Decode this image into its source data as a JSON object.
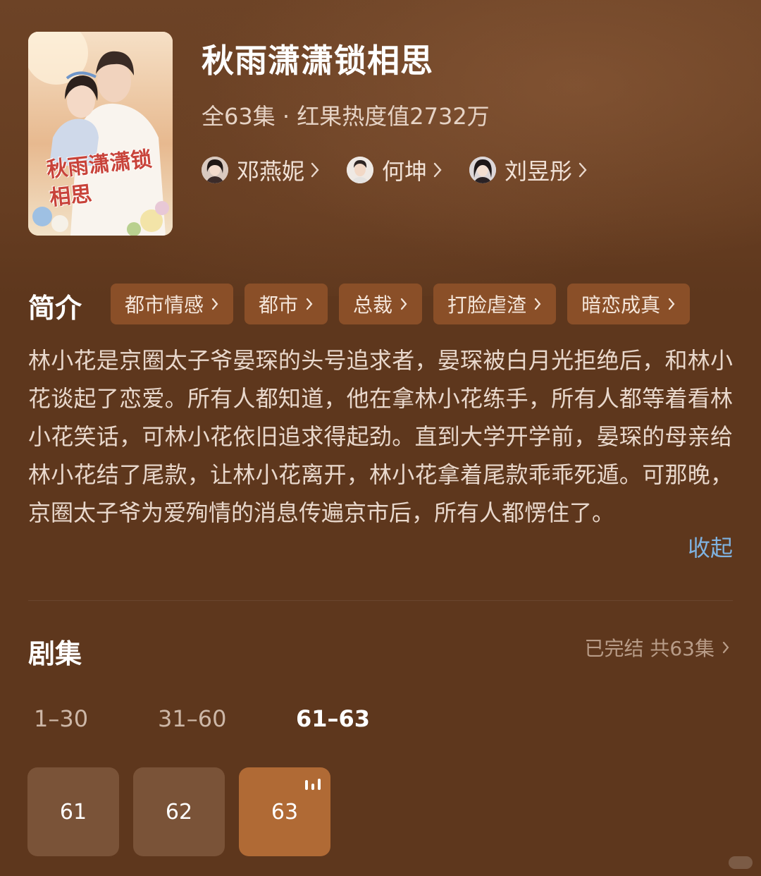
{
  "show": {
    "title": "秋雨潇潇锁相思",
    "meta": "全63集 · 红果热度值2732万",
    "poster_text": "秋雨潇潇锁相思"
  },
  "cast": [
    {
      "name": "邓燕妮",
      "icon": "avatar"
    },
    {
      "name": "何坤",
      "icon": "avatar"
    },
    {
      "name": "刘昱彤",
      "icon": "avatar"
    }
  ],
  "intro": {
    "heading": "简介",
    "tags": [
      "都市情感",
      "都市",
      "总裁",
      "打脸虐渣",
      "暗恋成真"
    ],
    "synopsis": "林小花是京圈太子爷晏琛的头号追求者，晏琛被白月光拒绝后，和林小花谈起了恋爱。所有人都知道，他在拿林小花练手，所有人都等着看林小花笑话，可林小花依旧追求得起劲。直到大学开学前，晏琛的母亲给林小花结了尾款，让林小花离开，林小花拿着尾款乖乖死遁。可那晚，京圈太子爷为爱殉情的消息传遍京市后，所有人都愣住了。",
    "collapse_label": "收起"
  },
  "episodes": {
    "heading": "剧集",
    "status": "已完结 共63集",
    "ranges": [
      "1–30",
      "31–60",
      "61–63"
    ],
    "active_range_index": 2,
    "items": [
      "61",
      "62",
      "63"
    ],
    "playing_index": 2
  },
  "colors": {
    "background": "#5e371d",
    "tag_bg": "#8a4f28",
    "episode_bg": "#7a5338",
    "episode_active_bg": "#b06a35",
    "link": "#7fb2e0"
  }
}
